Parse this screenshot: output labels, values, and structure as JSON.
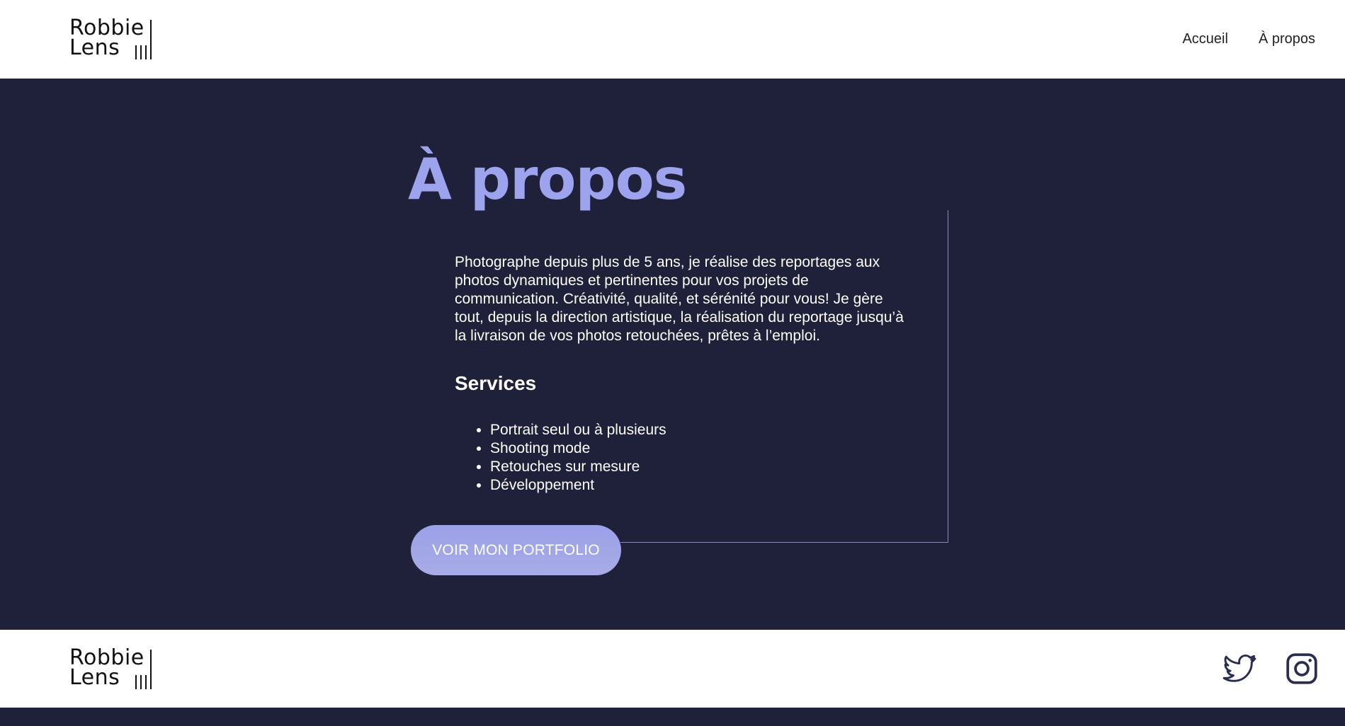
{
  "header": {
    "logo": {
      "line1": "Robbie",
      "line2": "Lens"
    },
    "nav": {
      "home_label": "Accueil",
      "about_label": "À propos"
    }
  },
  "main": {
    "title": "À propos",
    "intro": "Photographe depuis plus de 5 ans, je réalise des reportages aux photos dynamiques et pertinentes pour vos projets de communication. Créativité, qualité, et sérénité pour vous! Je gère tout, depuis la direction artistique, la réalisation du reportage jusqu’à la livraison de vos photos retouchées, prêtes à l’emploi.",
    "services_title": "Services",
    "services": [
      "Portrait seul ou à plusieurs",
      "Shooting mode",
      "Retouches sur mesure",
      "Développement"
    ],
    "cta_label": "VOIR MON PORTFOLIO"
  },
  "footer": {
    "logo": {
      "line1": "Robbie",
      "line2": "Lens"
    },
    "social": [
      "twitter-icon",
      "instagram-icon"
    ]
  },
  "colors": {
    "dark_bg": "#1f2039",
    "accent": "#9da3ec",
    "white": "#ffffff"
  }
}
